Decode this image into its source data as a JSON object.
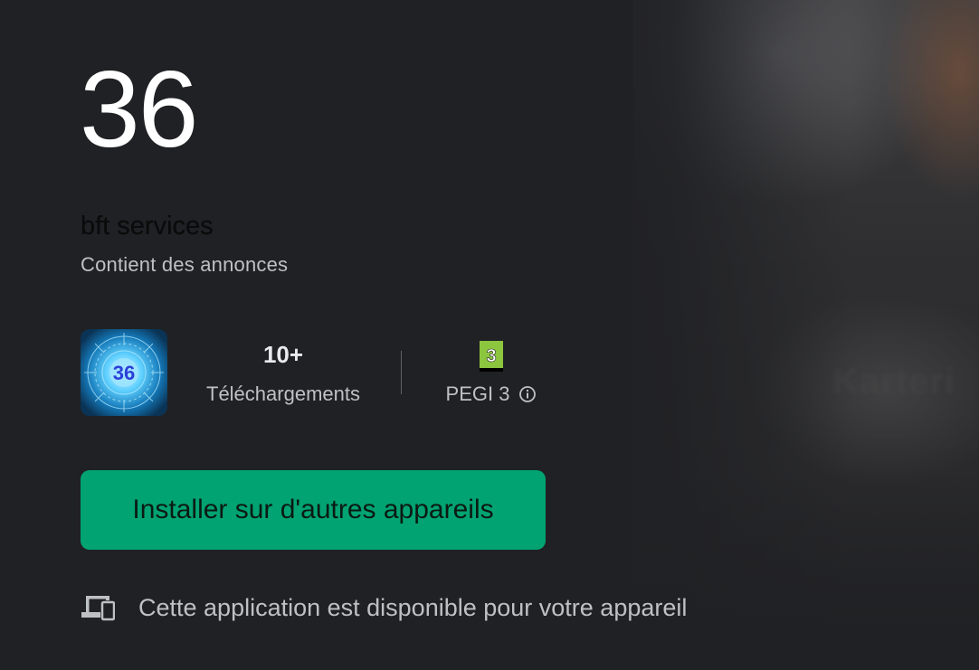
{
  "app": {
    "title": "36",
    "developer": "bft services",
    "ads_notice": "Contient des annonces",
    "icon_text": "36"
  },
  "stats": {
    "downloads_value": "10+",
    "downloads_label": "Téléchargements",
    "rating_badge": "3",
    "rating_label": "PEGI 3"
  },
  "actions": {
    "install_label": "Installer sur d'autres appareils"
  },
  "availability": {
    "text": "Cette application est disponible pour votre appareil"
  },
  "colors": {
    "background": "#202124",
    "accent": "#01a372",
    "pegi_green": "#8cc63f"
  },
  "icons": {
    "info": "info-icon",
    "devices": "devices-icon"
  }
}
